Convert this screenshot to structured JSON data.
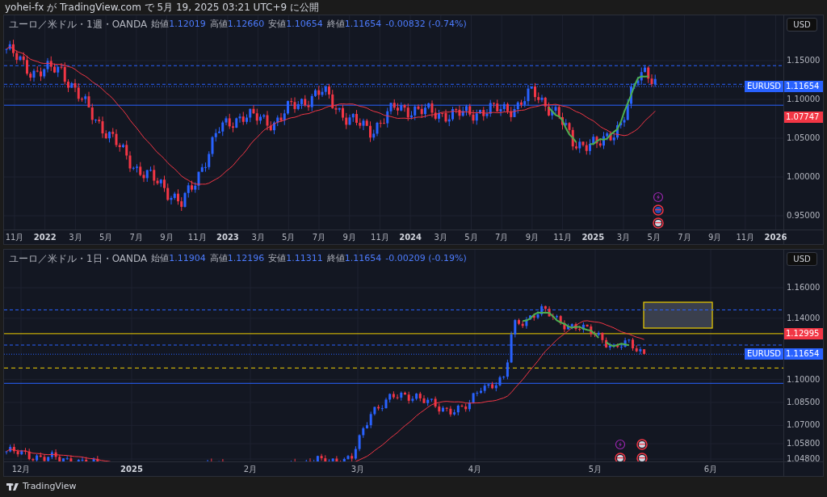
{
  "header": {
    "text": "yohei-fx が TradingView.com で 5月 19, 2025 03:21 UTC+9 に公開"
  },
  "panes": [
    {
      "legend": {
        "symbol": "ユーロ／米ドル・1週・OANDA",
        "fields": [
          {
            "label": "始値",
            "value": "1.12019"
          },
          {
            "label": "高値",
            "value": "1.12660"
          },
          {
            "label": "安値",
            "value": "1.10654"
          },
          {
            "label": "終値",
            "value": "1.11654"
          }
        ],
        "change": "-0.00832 (-0.74%)"
      },
      "currency": "USD",
      "price_ticks": [
        "1.15000",
        "1.10000",
        "1.05000",
        "1.00000",
        "0.95000"
      ],
      "price_tags": [
        {
          "kind": "symbol",
          "symbol": "EURUSD",
          "value": "1.11654",
          "color": "#2962ff"
        },
        {
          "kind": "plain",
          "value": "1.07747",
          "color": "#f23645"
        }
      ],
      "time_ticks": [
        {
          "label": "11月",
          "kind": "month"
        },
        {
          "label": "2022",
          "kind": "year"
        },
        {
          "label": "3月",
          "kind": "month"
        },
        {
          "label": "5月",
          "kind": "month"
        },
        {
          "label": "7月",
          "kind": "month"
        },
        {
          "label": "9月",
          "kind": "month"
        },
        {
          "label": "11月",
          "kind": "month"
        },
        {
          "label": "2023",
          "kind": "year"
        },
        {
          "label": "3月",
          "kind": "month"
        },
        {
          "label": "5月",
          "kind": "month"
        },
        {
          "label": "7月",
          "kind": "month"
        },
        {
          "label": "9月",
          "kind": "month"
        },
        {
          "label": "11月",
          "kind": "month"
        },
        {
          "label": "2024",
          "kind": "year"
        },
        {
          "label": "3月",
          "kind": "month"
        },
        {
          "label": "5月",
          "kind": "month"
        },
        {
          "label": "7月",
          "kind": "month"
        },
        {
          "label": "9月",
          "kind": "month"
        },
        {
          "label": "11月",
          "kind": "month"
        },
        {
          "label": "2025",
          "kind": "year"
        },
        {
          "label": "3月",
          "kind": "month"
        },
        {
          "label": "5月",
          "kind": "month"
        },
        {
          "label": "7月",
          "kind": "month"
        },
        {
          "label": "9月",
          "kind": "month"
        },
        {
          "label": "11月",
          "kind": "month"
        },
        {
          "label": "2026",
          "kind": "year"
        }
      ]
    },
    {
      "legend": {
        "symbol": "ユーロ／米ドル・1日・OANDA",
        "fields": [
          {
            "label": "始値",
            "value": "1.11904"
          },
          {
            "label": "高値",
            "value": "1.12196"
          },
          {
            "label": "安値",
            "value": "1.11311"
          },
          {
            "label": "終値",
            "value": "1.11654"
          }
        ],
        "change": "-0.00209 (-0.19%)"
      },
      "currency": "USD",
      "price_ticks": [
        "1.16000",
        "1.14000",
        "1.10000",
        "1.08500",
        "1.07000",
        "1.05800",
        "1.04800"
      ],
      "price_tags": [
        {
          "kind": "plain",
          "value": "1.12995",
          "color": "#f23645"
        },
        {
          "kind": "symbol",
          "symbol": "EURUSD",
          "value": "1.11654",
          "color": "#2962ff"
        }
      ],
      "time_ticks": [
        {
          "label": "12月",
          "kind": "month"
        },
        {
          "label": "2025",
          "kind": "year"
        },
        {
          "label": "2月",
          "kind": "month"
        },
        {
          "label": "3月",
          "kind": "month"
        },
        {
          "label": "4月",
          "kind": "month"
        },
        {
          "label": "5月",
          "kind": "month"
        },
        {
          "label": "6月",
          "kind": "month"
        }
      ]
    }
  ],
  "footer": {
    "brand": "TradingView"
  }
}
